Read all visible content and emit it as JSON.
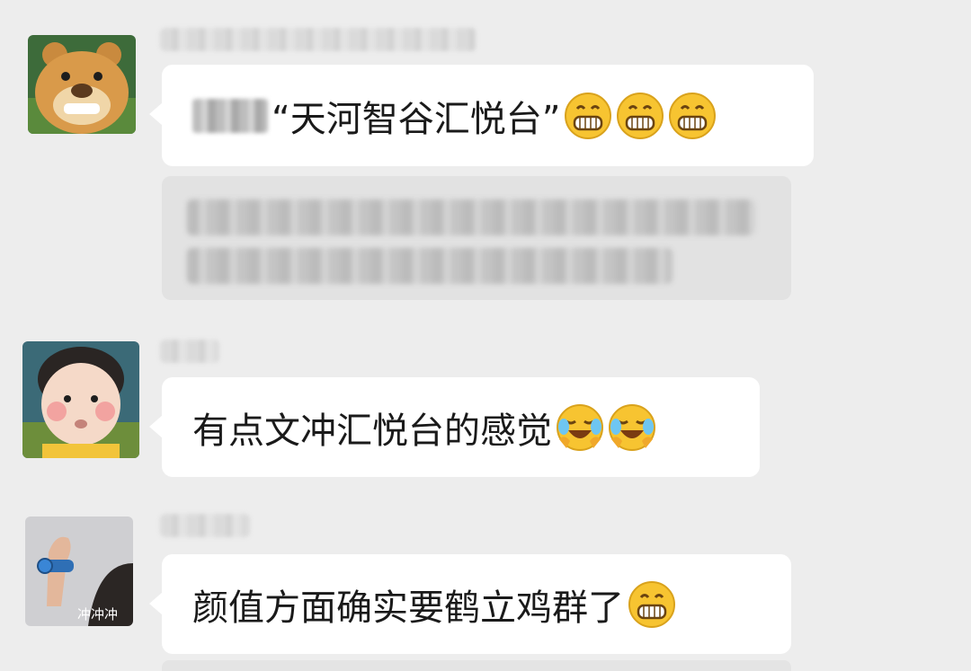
{
  "chat": {
    "messages": [
      {
        "avatar": "bear-face-avatar",
        "sender": "",
        "text": "“天河智谷汇悦台”",
        "emojis": [
          "grin-emoji",
          "grin-emoji",
          "grin-emoji"
        ],
        "has_quote": true
      },
      {
        "avatar": "baby-face-avatar",
        "sender": "",
        "text": "有点文冲汇悦台的感觉",
        "emojis": [
          "laugh-cry-emoji",
          "laugh-cry-emoji"
        ]
      },
      {
        "avatar": "hand-watch-avatar",
        "avatar_caption": "冲冲冲",
        "sender": "",
        "text": "颜值方面确实要鹤立鸡群了",
        "emojis": [
          "grin-emoji"
        ]
      }
    ]
  },
  "colors": {
    "background": "#ededed",
    "bubble": "#ffffff",
    "quote_bg": "#e2e2e2",
    "text": "#1a1a1a",
    "emoji_yellow": "#f7c431"
  }
}
